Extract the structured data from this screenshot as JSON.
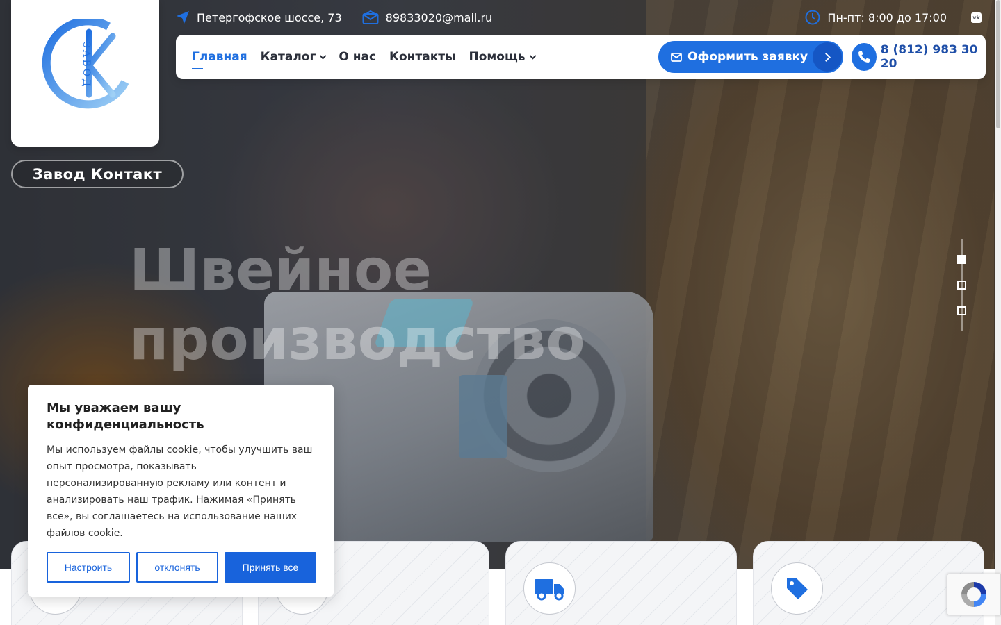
{
  "brand": {
    "name": "Завод Контакт",
    "logo_letters": "ЗАВОД",
    "logo_mark": "К"
  },
  "topbar": {
    "address": "Петергофское шоссе, 73",
    "email": "89833020@mail.ru",
    "hours": "Пн-пт: 8:00 до 17:00",
    "social": "vk"
  },
  "nav": {
    "items": [
      {
        "label": "Главная"
      },
      {
        "label": "Каталог"
      },
      {
        "label": "О нас"
      },
      {
        "label": "Контакты"
      },
      {
        "label": "Помощь"
      }
    ],
    "cta_label": "Оформить заявку",
    "phone": "8 (812) 983 30 20"
  },
  "hero": {
    "headline_line1": "Швейное",
    "headline_line2": "производство",
    "slides_count": 3,
    "active_slide": 1
  },
  "cookie": {
    "title": "Мы уважаем вашу конфиденциальность",
    "text": "Мы используем файлы cookie, чтобы улучшить ваш опыт просмотра, показывать персонализированную рекламу или контент и анализировать наш трафик. Нажимая «Принять все», вы соглашаетесь на использование наших файлов cookie.",
    "btn_customize": "Настроить",
    "btn_reject": "отклонять",
    "btn_accept": "Принять все"
  },
  "colors": {
    "accent": "#1f6fe0",
    "cookie_accent": "#1863dc",
    "nav_text": "#2b2f3a"
  },
  "icons": [
    "location-arrow-icon",
    "envelope-icon",
    "clock-icon",
    "vk-icon",
    "chevron-down-icon",
    "chevron-right-icon",
    "phone-icon",
    "truck-icon",
    "tag-icon",
    "recaptcha-icon"
  ]
}
